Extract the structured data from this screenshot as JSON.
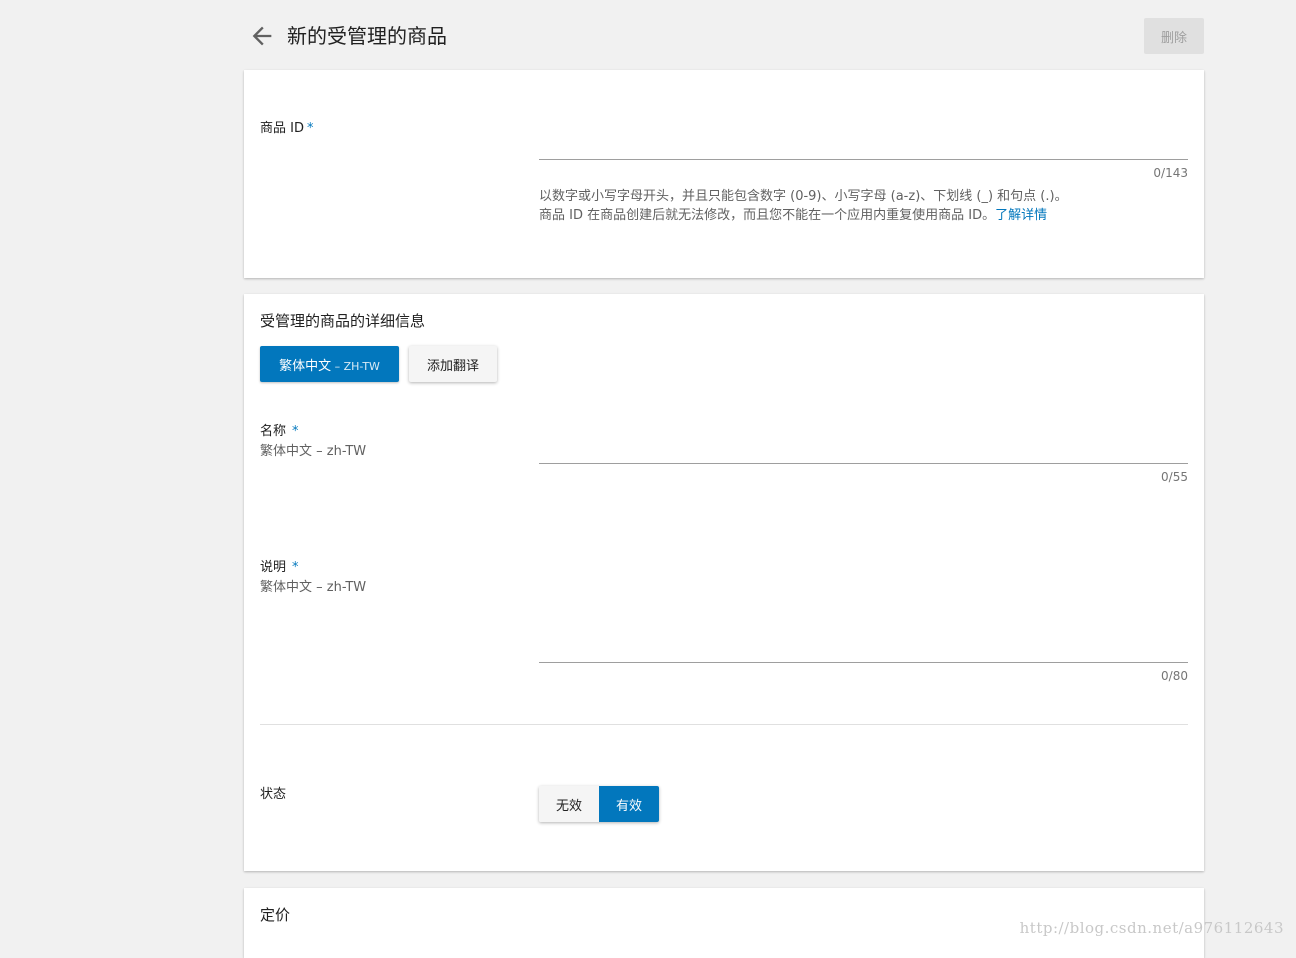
{
  "header": {
    "title": "新的受管理的商品",
    "delete_label": "删除"
  },
  "product_id": {
    "label": "商品 ID",
    "required_mark": "*",
    "counter": "0/143",
    "helper_line1": "以数字或小写字母开头，并且只能包含数字 (0-9)、小写字母 (a-z)、下划线 (_) 和句点 (.)。",
    "helper_line2": "商品 ID 在商品创建后就无法修改，而且您不能在一个应用内重复使用商品 ID。",
    "learn_more": "了解详情"
  },
  "details": {
    "section_title": "受管理的商品的详细信息",
    "language_button": "繁体中文",
    "language_code": " – ZH-TW",
    "add_translation": "添加翻译",
    "name": {
      "label": "名称",
      "required_mark": "*",
      "sub": "繁体中文 – zh-TW",
      "counter": "0/55"
    },
    "description": {
      "label": "说明",
      "required_mark": "*",
      "sub": "繁体中文 – zh-TW",
      "counter": "0/80"
    },
    "status": {
      "label": "状态",
      "inactive": "无效",
      "active": "有效",
      "selected": "有效"
    }
  },
  "pricing": {
    "section_title": "定价"
  },
  "watermark": "http://blog.csdn.net/a976112643",
  "colors": {
    "accent": "#0277bd",
    "background": "#f1f1f1"
  }
}
